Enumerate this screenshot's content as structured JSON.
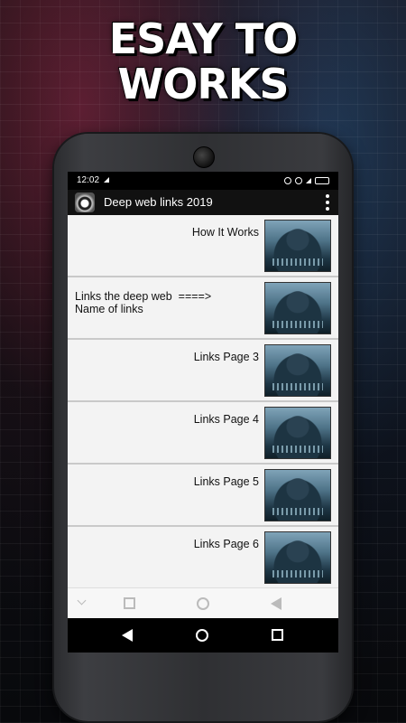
{
  "promo": {
    "title_line1": "ESAY TO",
    "title_line2": "WORKS"
  },
  "status_bar": {
    "time": "12:02"
  },
  "app_bar": {
    "title": "Deep web links 2019"
  },
  "list": {
    "items": [
      {
        "label": "How It Works",
        "align": "right"
      },
      {
        "label_line1": "Links the deep web  ====>",
        "label_line2": "Name of links",
        "align": "left"
      },
      {
        "label": "Links Page 3",
        "align": "right"
      },
      {
        "label": "Links Page 4",
        "align": "right"
      },
      {
        "label": "Links Page 5",
        "align": "right"
      },
      {
        "label": "Links Page 6",
        "align": "right"
      }
    ]
  },
  "icons": {
    "status": [
      "signal-icon",
      "alarm-icon",
      "battery-icon"
    ],
    "app_bar": [
      "app-logo-icon",
      "overflow-menu-icon"
    ],
    "inner_nav": [
      "chevron-down-icon",
      "square-icon",
      "circle-icon",
      "triangle-back-icon"
    ],
    "system_nav": [
      "back-icon",
      "home-icon",
      "recents-icon"
    ]
  },
  "colors": {
    "app_bar": "#111111",
    "list_bg": "#f2f2f2",
    "divider": "#c9c9c9"
  }
}
